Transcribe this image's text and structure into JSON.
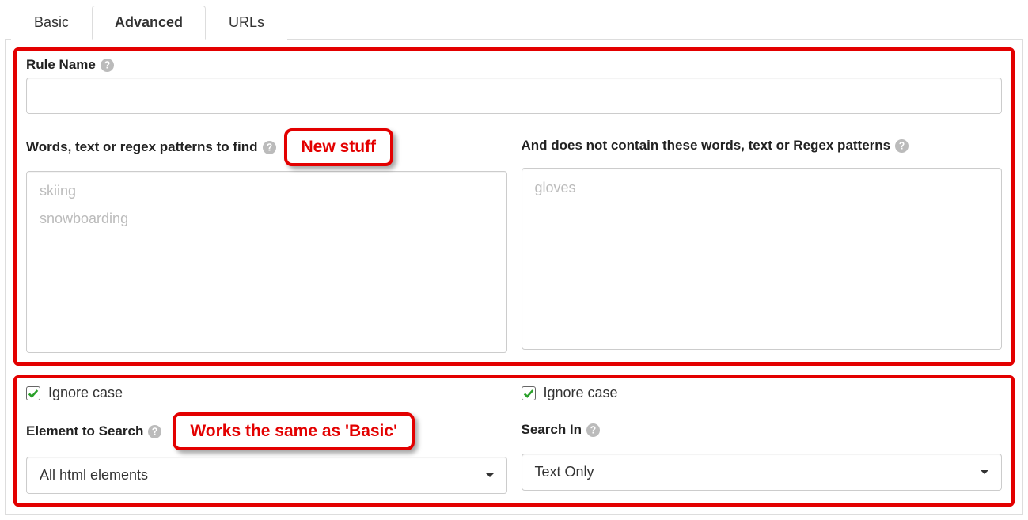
{
  "tabs": {
    "basic": "Basic",
    "advanced": "Advanced",
    "urls": "URLs"
  },
  "annotations": {
    "new_stuff": "New stuff",
    "works_basic": "Works the same as 'Basic'"
  },
  "ruleName": {
    "label": "Rule Name",
    "value": ""
  },
  "include": {
    "label": "Words, text or regex patterns to find",
    "tags": [
      "skiing",
      "snowboarding"
    ]
  },
  "exclude": {
    "label": "And does not contain these words, text or Regex patterns",
    "tags": [
      "gloves"
    ]
  },
  "leftOptions": {
    "ignoreCase": {
      "label": "Ignore case",
      "checked": true
    },
    "elementLabel": "Element to Search",
    "elementValue": "All html elements"
  },
  "rightOptions": {
    "ignoreCase": {
      "label": "Ignore case",
      "checked": true
    },
    "searchInLabel": "Search In",
    "searchInValue": "Text Only"
  }
}
